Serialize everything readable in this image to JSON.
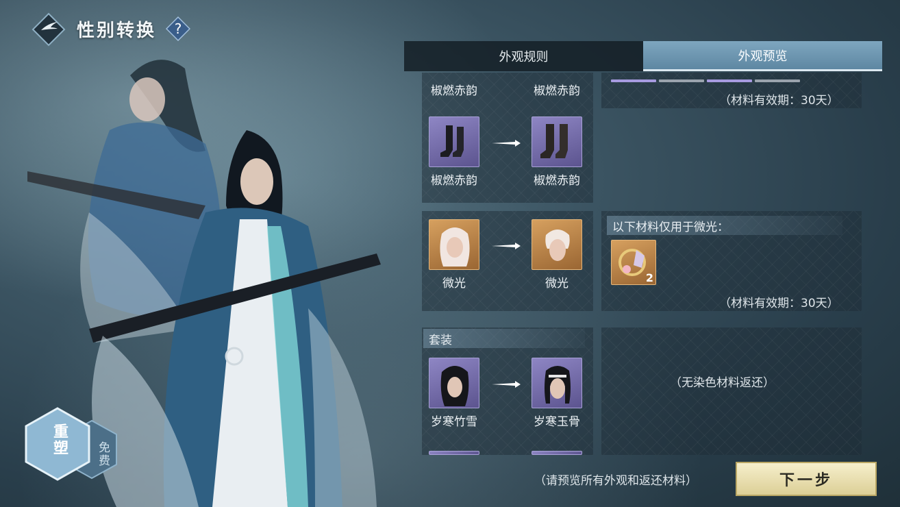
{
  "header": {
    "title": "性别转换",
    "help": "?"
  },
  "tabs": [
    {
      "label": "外观规则",
      "active": false
    },
    {
      "label": "外观预览",
      "active": true
    }
  ],
  "conversions": [
    {
      "from_label": "椒燃赤韵",
      "to_label": "椒燃赤韵",
      "icon": "partial-row",
      "rarity": "purple"
    },
    {
      "from_label": "椒燃赤韵",
      "to_label": "椒燃赤韵",
      "icon": "boots-icon",
      "rarity": "purple"
    },
    {
      "from_label": "微光",
      "to_label": "微光",
      "icon": "hair-icon",
      "rarity": "orange"
    },
    {
      "from_label": "岁寒竹雪",
      "to_label": "岁寒玉骨",
      "icon": "hair-icon",
      "rarity": "purple"
    }
  ],
  "sections": {
    "set_title": "套装"
  },
  "right_panels": {
    "validity_1": "（材料有效期：30天）",
    "materials_title": "以下材料仅用于微光：",
    "material_count": "2",
    "validity_2": "（材料有效期：30天）",
    "no_dye": "（无染色材料返还）"
  },
  "footer": {
    "hint": "（请预览所有外观和返还材料）",
    "next_label": "下一步"
  },
  "rebuild": {
    "label": "重塑",
    "free": "免费"
  },
  "colors": {
    "accent_tab": "#7ea6bf",
    "purple": "#8e86c4",
    "orange": "#d6a05f",
    "next_btn": "#f6efcc"
  }
}
